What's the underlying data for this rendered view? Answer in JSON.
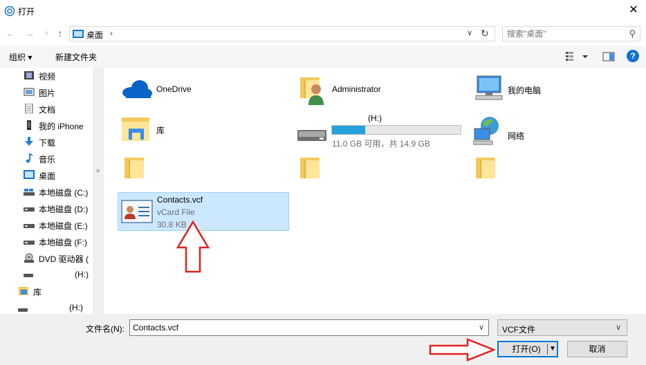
{
  "window": {
    "title": "打开"
  },
  "address": {
    "crumb": "桌面",
    "search_placeholder": "搜索\"桌面\""
  },
  "toolbar": {
    "organize": "组织 ▾",
    "new_folder": "新建文件夹"
  },
  "sidebar": {
    "items": [
      {
        "label": "视频",
        "icon": "video-icon"
      },
      {
        "label": "图片",
        "icon": "pictures-icon"
      },
      {
        "label": "文档",
        "icon": "documents-icon"
      },
      {
        "label": "我的 iPhone",
        "icon": "iphone-icon"
      },
      {
        "label": "下载",
        "icon": "download-icon"
      },
      {
        "label": "音乐",
        "icon": "music-icon"
      },
      {
        "label": "桌面",
        "icon": "desktop-icon"
      },
      {
        "label": "本地磁盘 (C:)",
        "icon": "drive-icon"
      },
      {
        "label": "本地磁盘 (D:)",
        "icon": "drive-icon"
      },
      {
        "label": "本地磁盘 (E:)",
        "icon": "drive-icon"
      },
      {
        "label": "本地磁盘 (F:)",
        "icon": "drive-icon"
      },
      {
        "label": "DVD 驱动器 (",
        "icon": "dvd-icon"
      },
      {
        "label": "(H:)",
        "icon": "usb-drive-icon"
      },
      {
        "label": "库",
        "icon": "library-icon"
      },
      {
        "label": "(H:)",
        "icon": "usb-drive-icon"
      }
    ]
  },
  "content": {
    "onedrive": "OneDrive",
    "administrator": "Administrator",
    "my_computer": "我的电脑",
    "library": "库",
    "drive_h_label": "(H:)",
    "drive_h_space": "11.0 GB 可用，共 14.9 GB",
    "drive_h_used_fraction": 0.26,
    "network": "网络",
    "file_name": "Contacts.vcf",
    "file_type": "vCard File",
    "file_size": "30.8 KB"
  },
  "bottom": {
    "filename_label": "文件名(N):",
    "filename_value": "Contacts.vcf",
    "filetype_value": "VCF文件",
    "open_label": "打开(O)",
    "cancel_label": "取消"
  },
  "colors": {
    "accent": "#0078d7",
    "selection": "#cce8ff",
    "annotation_arrow": "#e02020",
    "drive_fill": "#26a0da"
  }
}
